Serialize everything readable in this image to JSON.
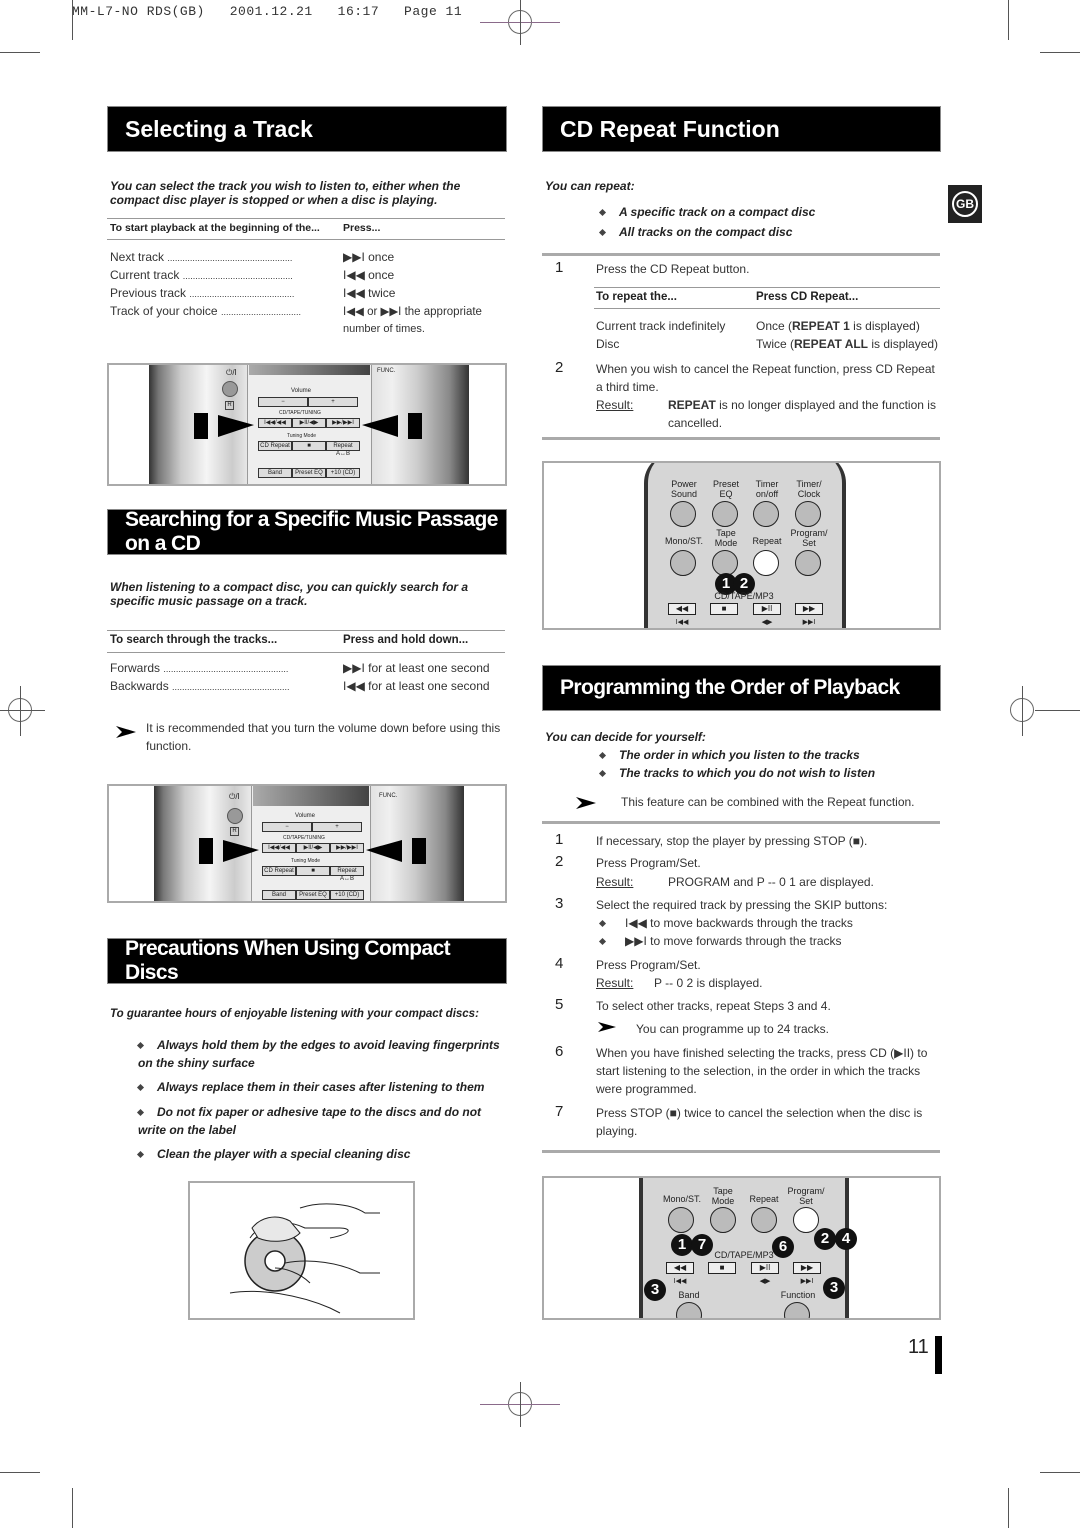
{
  "print_header": "MM-L7-NO RDS(GB)   2001.12.21   16:17   Page 11",
  "language_badge": "GB",
  "page_number": "11",
  "selecting_track": {
    "title": "Selecting a Track",
    "intro": "You can select the track you wish to listen to, either when the compact disc player is stopped or when a disc is playing.",
    "col1": "To start playback at the beginning of the...",
    "col2": "Press...",
    "rows": [
      {
        "label": "Next track",
        "dots": "..................................................",
        "action": "▶▶I once"
      },
      {
        "label": "Current track",
        "dots": "............................................",
        "action": "I◀◀ once"
      },
      {
        "label": "Previous track",
        "dots": "..........................................",
        "action": "I◀◀ twice"
      },
      {
        "label": "Track of your choice",
        "dots": "................................",
        "action": "I◀◀ or ▶▶I the appropriate"
      }
    ],
    "row_continuation": "number of times."
  },
  "unit_panel": {
    "power_label": "⏻/I",
    "func_label": "FUNC.",
    "volume_label": "Volume",
    "vol_minus": "−",
    "vol_plus": "+",
    "cd_tape_tuning": "CD/TAPE/TUNING",
    "skip_back": "I◀◀/◀◀",
    "play_pause": "▶II/◀▶",
    "skip_fwd": "▶▶/▶▶I",
    "tuning_mode": "Tuning Mode",
    "cd_repeat": "CD Repeat",
    "stop": "■",
    "repeat_ab": "Repeat A↔B",
    "band": "Band",
    "preset_eq": "Preset EQ",
    "plus10": "+10 (CD)",
    "r_label": "R"
  },
  "searching": {
    "title": "Searching for a Specific Music Passage on a CD",
    "intro": "When listening to a compact disc, you can quickly search for a specific music passage on a track.",
    "col1": "To search through the tracks...",
    "col2": "Press and  hold down...",
    "rows": [
      {
        "label": "Forwards",
        "dots": "..................................................",
        "action": "▶▶I for at least one second"
      },
      {
        "label": "Backwards",
        "dots": "...............................................",
        "action": "I◀◀ for at least one second"
      }
    ],
    "note": "It is recommended that you turn the volume down before using this function."
  },
  "precautions": {
    "title": "Precautions When Using Compact Discs",
    "intro": "To guarantee hours of enjoyable listening with your compact discs:",
    "bullets": [
      "Always hold them by the edges to avoid leaving fingerprints on the shiny surface",
      "Always replace them in their cases after listening to them",
      "Do not fix paper or adhesive tape to the discs and do not write on the label",
      "Clean the player with a special cleaning disc"
    ]
  },
  "cd_repeat": {
    "title": "CD Repeat Function",
    "intro": "You can repeat:",
    "bullets": [
      "A specific track on a compact disc",
      "All tracks on the compact disc"
    ],
    "step1_num": "1",
    "step1": "Press the CD Repeat button.",
    "col1": "To repeat the...",
    "col2": "Press CD Repeat...",
    "rows": [
      {
        "label": "Current track indefinitely",
        "pre": "Once (",
        "bold": "REPEAT 1",
        "post": " is displayed)"
      },
      {
        "label": "Disc",
        "pre": "Twice (",
        "bold": "REPEAT ALL",
        "post": " is displayed)"
      }
    ],
    "step2_num": "2",
    "step2": "When you wish to cancel the Repeat function, press CD Repeat a third time.",
    "result_label": "Result:",
    "result_bold": "REPEAT",
    "result_text": " is no longer displayed and the function is cancelled."
  },
  "remote1": {
    "row1": [
      "Power\nSound",
      "Preset\nEQ",
      "Timer\non/off",
      "Timer/\nClock"
    ],
    "row2": [
      "Mono/ST.",
      "Tape\nMode",
      "Repeat",
      "Program/\nSet"
    ],
    "group_label": "CD/TAPE/MP3",
    "transport": [
      "◀◀",
      "■",
      "▶II",
      "▶▶"
    ],
    "transport_sub": [
      "I◀◀",
      "",
      "◀▶",
      "▶▶I"
    ],
    "callouts": [
      "1",
      "2"
    ]
  },
  "programming": {
    "title": "Programming the Order of Playback",
    "intro": "You can decide for yourself:",
    "bullets": [
      "The order in which you listen to the tracks",
      "The tracks to which you do not wish to listen"
    ],
    "note": "This feature can be combined with the Repeat function.",
    "steps": [
      {
        "num": "1",
        "text": "If necessary, stop the player by pressing STOP (■)."
      },
      {
        "num": "2",
        "text": "Press Program/Set.",
        "result_label": "Result:",
        "result": "PROGRAM and P -- 0 1 are displayed."
      },
      {
        "num": "3",
        "text": "Select the required track by pressing the SKIP buttons:",
        "subs": [
          "I◀◀ to move backwards through the tracks",
          "▶▶I to move forwards through the tracks"
        ]
      },
      {
        "num": "4",
        "text": "Press Program/Set.",
        "result_label": "Result:",
        "result": "P -- 0 2 is displayed."
      },
      {
        "num": "5",
        "text": "To select other tracks, repeat Steps 3 and 4.",
        "note": "You can programme up to 24 tracks."
      },
      {
        "num": "6",
        "text": "When you have finished selecting the tracks, press CD (▶II) to start listening to the selection, in the order in which the tracks were programmed."
      },
      {
        "num": "7",
        "text": "Press STOP (■) twice to cancel the selection when the disc is playing."
      }
    ]
  },
  "remote2": {
    "row": [
      "Mono/ST.",
      "Tape\nMode",
      "Repeat",
      "Program/\nSet"
    ],
    "group_label": "CD/TAPE/MP3",
    "transport": [
      "◀◀",
      "■",
      "▶II",
      "▶▶"
    ],
    "transport_sub": [
      "I◀◀",
      "",
      "◀▶",
      "▶▶I"
    ],
    "bottom": [
      "Band",
      "Function"
    ],
    "callouts": [
      "1",
      "7",
      "6",
      "2",
      "4",
      "3",
      "3"
    ]
  }
}
